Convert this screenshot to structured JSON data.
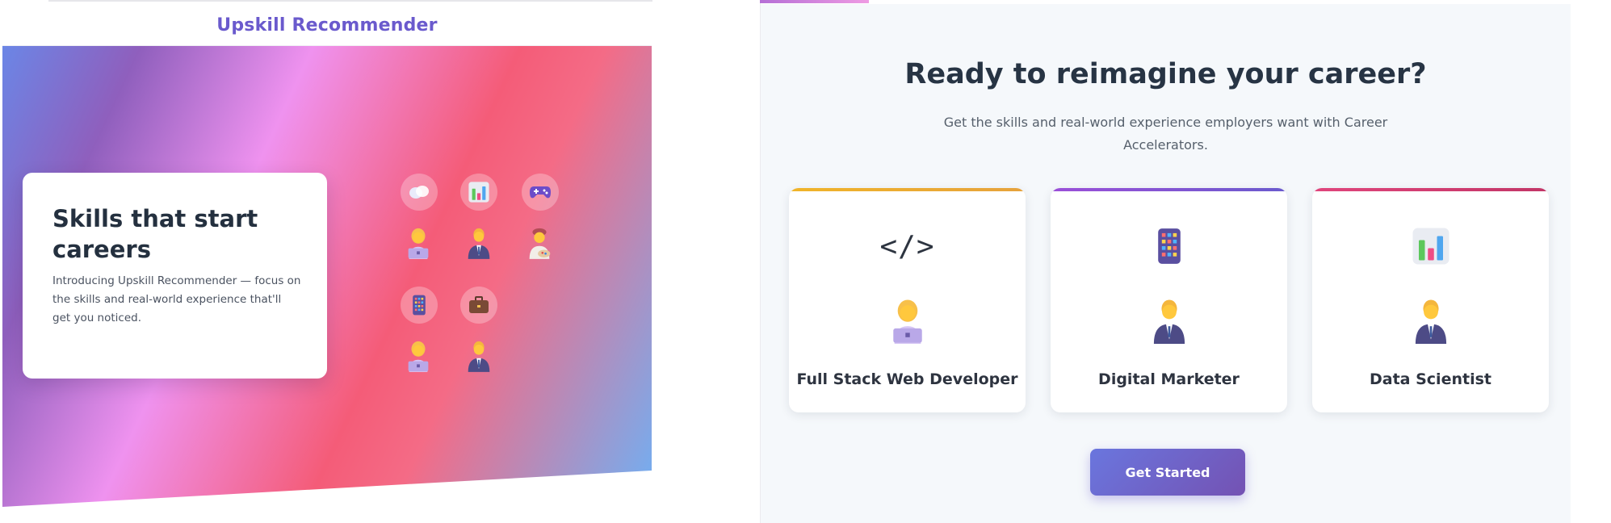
{
  "left": {
    "app_title": "Upskill Recommender",
    "hero": {
      "heading": "Skills that start careers",
      "description": "Introducing Upskill Recommender — focus on the skills and real-world experience that'll get you noticed.",
      "icons": [
        "bubbles-icon",
        "bar-chart-icon",
        "gamepad-icon",
        "calculator-icon",
        "briefcase-icon"
      ],
      "people": [
        "technologist-icon",
        "office-worker-icon",
        "artist-icon",
        "technologist-icon",
        "office-worker-icon"
      ]
    }
  },
  "right": {
    "title": "Ready to reimagine your career?",
    "subtitle": "Get the skills and real-world experience employers want with Career Accelerators.",
    "cards": [
      {
        "label": "Full Stack Web Developer",
        "icon": "</>",
        "accent": "#f0b429"
      },
      {
        "label": "Digital Marketer",
        "icon": "calculator-icon",
        "accent": "#8b4fd8"
      },
      {
        "label": "Data Scientist",
        "icon": "bar-chart-icon",
        "accent": "#d63d7a"
      }
    ],
    "cta_label": "Get Started"
  },
  "colors": {
    "brand": "#6a5acd",
    "text_dark": "#273444",
    "panel_bg": "#f5f8fb",
    "button_start": "#6a76de",
    "button_end": "#7452b3"
  }
}
